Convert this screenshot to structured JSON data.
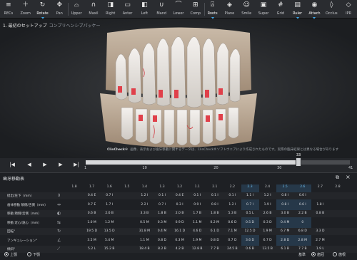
{
  "colors": {
    "accent": "#3da5e6",
    "red_marker": "#e0404a"
  },
  "toolbar": {
    "items": [
      {
        "label": "RECs",
        "icon": "≡"
      },
      {
        "label": "Zoom",
        "icon": "＋"
      },
      {
        "label": "Rotate",
        "icon": "↻"
      },
      {
        "label": "Pan",
        "icon": "✥"
      },
      {
        "label": "Upper",
        "icon": "⌓"
      },
      {
        "label": "Maxil",
        "icon": "∩"
      },
      {
        "label": "Right",
        "icon": "◨"
      },
      {
        "label": "Anter",
        "icon": "▭"
      },
      {
        "label": "Left",
        "icon": "◧"
      },
      {
        "label": "Mand",
        "icon": "∪"
      },
      {
        "label": "Lower",
        "icon": "⌒"
      },
      {
        "label": "Comp",
        "icon": "⊞"
      },
      {
        "label": "Roots",
        "icon": "⍓"
      },
      {
        "label": "Plane",
        "icon": "◈"
      },
      {
        "label": "Smile",
        "icon": "☺"
      },
      {
        "label": "Super",
        "icon": "▣"
      },
      {
        "label": "Grid",
        "icon": "#"
      },
      {
        "label": "Ruler",
        "icon": "▤"
      },
      {
        "label": "Attach",
        "icon": "◉"
      },
      {
        "label": "Occlus",
        "icon": "◊"
      },
      {
        "label": "IPR",
        "icon": "◇"
      }
    ]
  },
  "viewport": {
    "title": "1. 最初のセットアップ",
    "subtitle": "コンプリヘンシブパッケー",
    "footer_brand": "ClinCheck®",
    "footer_text": "画像、表示および歯牙移動に関するデータは、ClinCheck®ソフトウェアにより作成されたものです。実際の臨床結果とは異なる場合があります"
  },
  "timeline": {
    "current": "33",
    "progress": 0.805,
    "ticks": [
      "1",
      "10",
      "20",
      "30",
      "41"
    ]
  },
  "panel": {
    "title": "歯牙移動表",
    "columns": [
      "1.8",
      "1.7",
      "1.6",
      "1.5",
      "1.4",
      "1.3",
      "1.2",
      "1.1",
      "2.1",
      "2.2",
      "2.3",
      "2.4",
      "2.5",
      "2.6",
      "2.7",
      "2.8"
    ],
    "highlight_columns": [
      10,
      12,
      13
    ],
    "rows": [
      {
        "label": "挺出/圧下（mm）",
        "values": [
          "",
          "0.4 E",
          "0.7 I",
          "",
          "1.2 I",
          "0.1 I",
          "0.4 E",
          "0.1 I",
          "0.1 I",
          "0.1 I",
          "1.1 I",
          "1.2 I",
          "0.8 I",
          "0.6 I",
          "",
          ""
        ]
      },
      {
        "label": "歯体移動 頬側/舌側（mm）",
        "values": [
          "",
          "0.7 E",
          "1.7 I",
          "",
          "2.2 I",
          "0.7 I",
          "0.3 I",
          "0.9 I",
          "0.8 I",
          "1.2 I",
          "0.7 I",
          "1.9 I",
          "0.8 I",
          "0.6 I",
          "1.8 I",
          ""
        ]
      },
      {
        "label": "移動 頬側/舌側（mm）",
        "values": [
          "",
          "0.6 B",
          "2.6 B",
          "",
          "3.3 B",
          "1.8 B",
          "2.0 B",
          "1.7 B",
          "1.8 B",
          "5.3 B",
          "0.5 L",
          "2.6 B",
          "3.0 B",
          "2.2 B",
          "0.8 B",
          ""
        ]
      },
      {
        "label": "移動 近心/遠心（mm）",
        "values": [
          "",
          "1.0 M",
          "1.2 M",
          "",
          "0.5 M",
          "0.3 M",
          "0.9 D",
          "1.1 M",
          "0.2 M",
          "0.6 D",
          "0.5 D",
          "0.3 D",
          "0.4 M",
          "0",
          "",
          ""
        ]
      },
      {
        "label": "回転°",
        "values": [
          "",
          "19.5 D",
          "13.5 D",
          "",
          "31.8 M",
          "0.4 M",
          "16.1 D",
          "4.6 D",
          "6.1 D",
          "7.1 M",
          "12.5 D",
          "1.9 M",
          "6.7 M",
          "6.8 D",
          "3.3 D",
          ""
        ]
      },
      {
        "label": "アンギュレーション°",
        "values": [
          "",
          "3.5 M",
          "5.4 M",
          "",
          "1.1 M",
          "0.8 D",
          "0.3 M",
          "1.9 M",
          "0.8 D",
          "0.7 D",
          "3.6 D",
          "6.7 D",
          "2.8 D",
          "2.8 M",
          "2.7 M",
          ""
        ]
      },
      {
        "label": "傾斜°",
        "values": [
          "",
          "5.2 L",
          "15.2 B",
          "",
          "18.4 B",
          "8.2 B",
          "4.2 B",
          "12.8 B",
          "7.7 B",
          "24.5 B",
          "0.6 B",
          "13.5 B",
          "6.1 B",
          "7.7 B",
          "1.9 L",
          ""
        ]
      }
    ],
    "footer": {
      "upper": "上顎",
      "lower": "下顎",
      "reference_label": "基準",
      "crown": "歯冠",
      "root": "歯根"
    }
  }
}
